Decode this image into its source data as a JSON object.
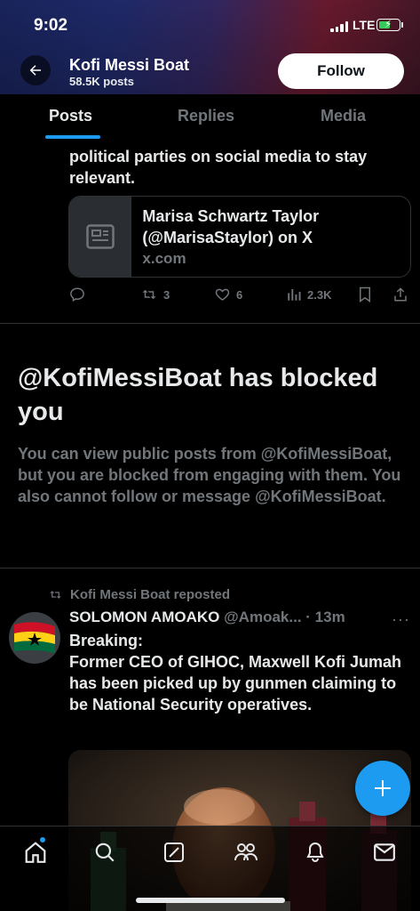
{
  "status_bar": {
    "time": "9:02",
    "network": "LTE",
    "battery_charging": true
  },
  "header": {
    "title": "Kofi Messi Boat",
    "subtitle": "58.5K posts",
    "follow_label": "Follow"
  },
  "tabs": [
    {
      "label": "Posts",
      "active": true
    },
    {
      "label": "Replies",
      "active": false
    },
    {
      "label": "Media",
      "active": false
    }
  ],
  "prev_post": {
    "text": "political parties on social media to stay relevant.",
    "link_card": {
      "title": "Marisa Schwartz Taylor (@MarisaStaylor) on X",
      "domain": "x.com"
    },
    "actions": {
      "replies": "",
      "reposts": "3",
      "likes": "6",
      "views": "2.3K"
    }
  },
  "blocked_notice": {
    "title": "@KofiMessiBoat has blocked you",
    "body": "You can view public posts from @KofiMessiBoat, but you are blocked from engaging with them. You also cannot follow or message @KofiMessiBoat."
  },
  "repost": {
    "repost_label": "Kofi Messi Boat reposted",
    "author_name": "SOLOMON AMOAKO",
    "author_handle": "@Amoak...",
    "time": "· 13m",
    "text_line1": "Breaking:",
    "text_body": "Former CEO of GIHOC, Maxwell Kofi Jumah has been picked up by gunmen claiming to be National Security operatives."
  },
  "bottom_nav": [
    "home-icon",
    "search-icon",
    "grok-icon",
    "communities-icon",
    "notifications-icon",
    "messages-icon"
  ],
  "colors": {
    "accent": "#1d9bf0",
    "text": "#e7e9ea",
    "muted": "#71767b",
    "border": "#2f3336"
  }
}
